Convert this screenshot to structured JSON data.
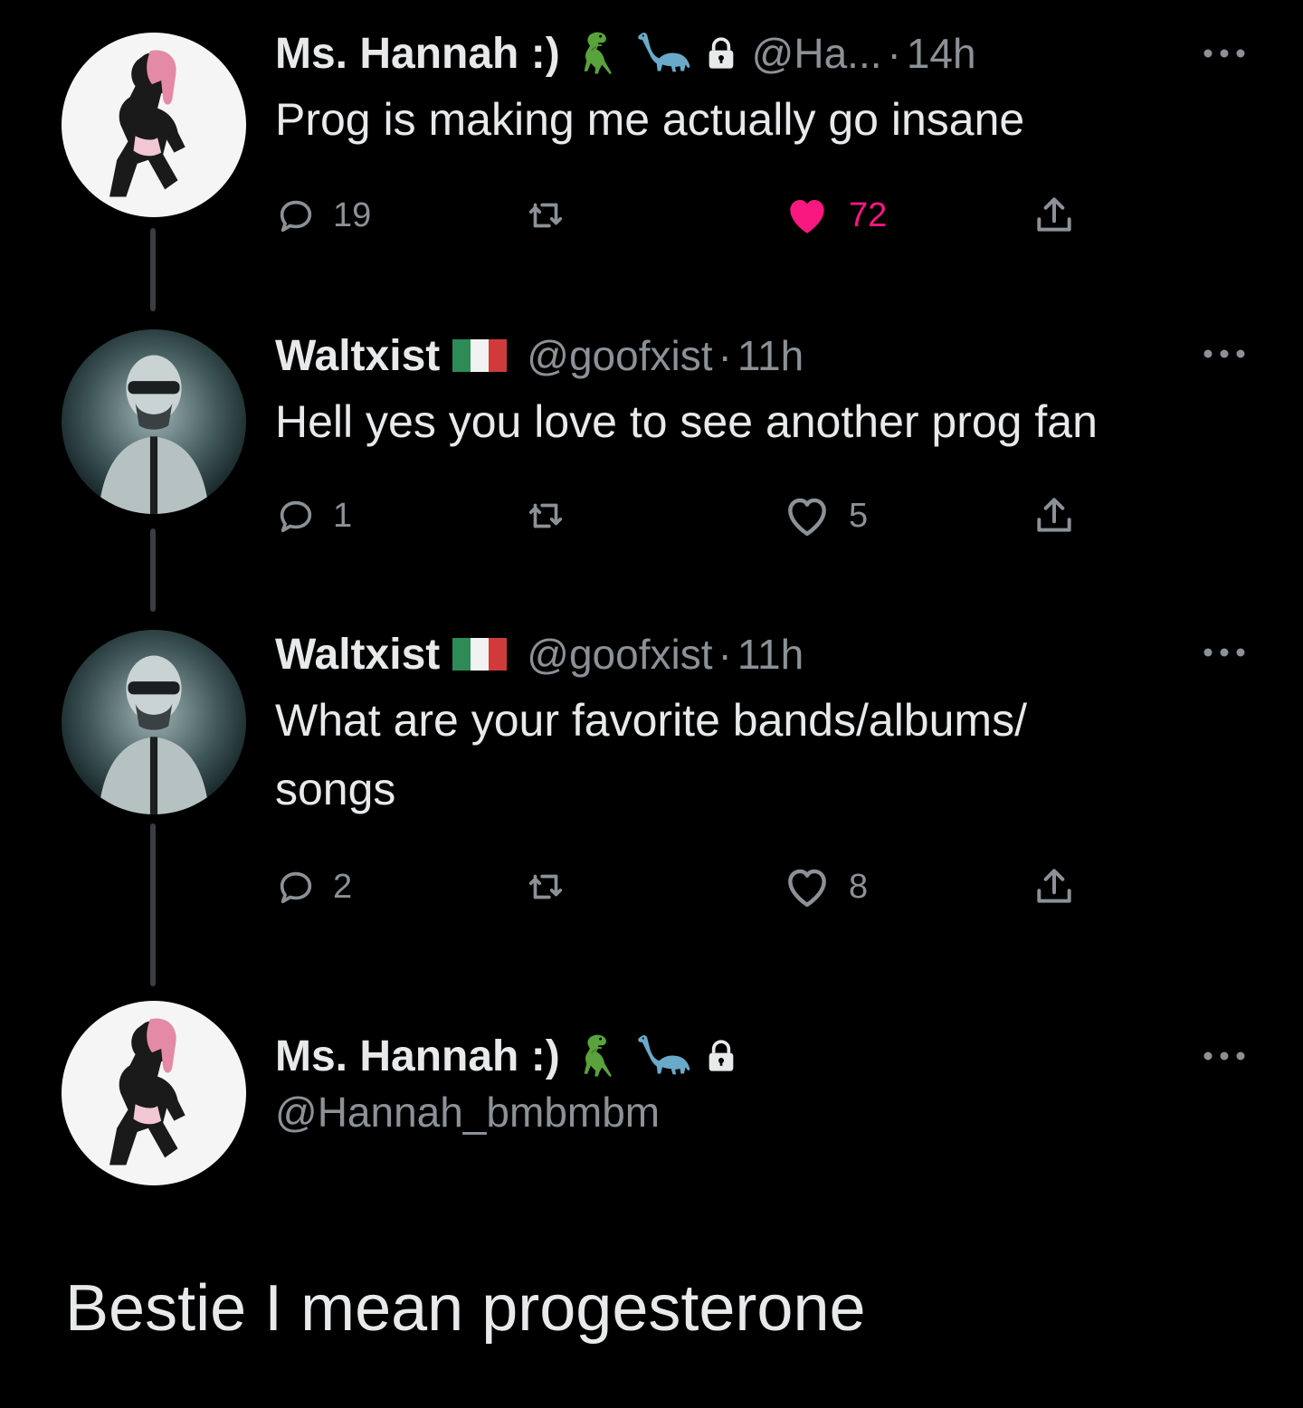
{
  "tweets": [
    {
      "name": "Ms. Hannah :)",
      "handle": "@Ha...",
      "dot": "·",
      "time": "14h",
      "text": "Prog is making me actually go insane",
      "replies": "19",
      "likes": "72",
      "liked": true,
      "badges": [
        "t-rex-emoji",
        "sauropod-emoji",
        "lock-icon"
      ]
    },
    {
      "name": "Waltxist",
      "handle": "@goofxist",
      "dot": "·",
      "time": "11h",
      "text": "Hell yes you love to see another prog fan",
      "replies": "1",
      "likes": "5",
      "liked": false,
      "badges": [
        "italy-flag-emoji"
      ]
    },
    {
      "name": "Waltxist",
      "handle": "@goofxist",
      "dot": "·",
      "time": "11h",
      "text_line1": "What are your favorite bands/albums/",
      "text_line2": "songs",
      "replies": "2",
      "likes": "8",
      "liked": false,
      "badges": [
        "italy-flag-emoji"
      ]
    },
    {
      "name": "Ms. Hannah :)",
      "handle": "@Hannah_bmbmbm",
      "badges": [
        "t-rex-emoji",
        "sauropod-emoji",
        "lock-icon"
      ]
    }
  ],
  "caption": "Bestie I mean progesterone",
  "colors": {
    "background": "#000000",
    "text": "#e7e9ea",
    "muted": "#8b9197",
    "like": "#f91880",
    "thread_line": "#3a3d41"
  }
}
